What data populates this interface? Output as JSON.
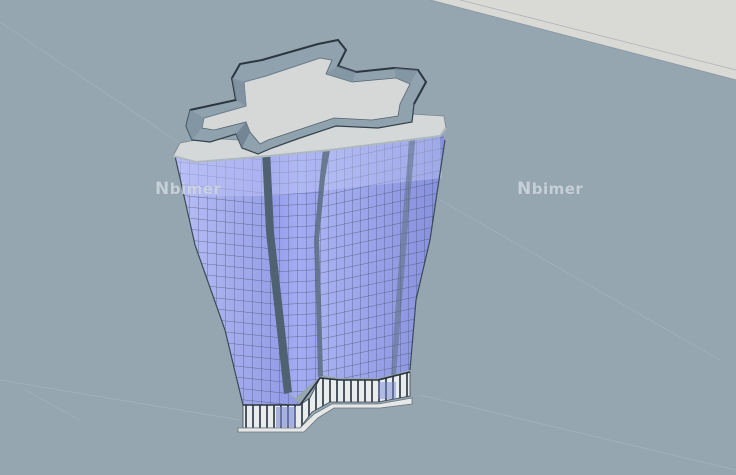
{
  "scene": {
    "ground_color": "#96a6b0",
    "sky_color": "#ffffff",
    "horizon_band_color": "#d8d8d6",
    "glass_front_color": "#9ea6ee",
    "glass_side_color": "#aab1f0",
    "glass_dark_color": "#7f8ad8",
    "mullion_color": "#2a3440",
    "frame_color": "#4f6272",
    "roof_color": "#d4d6d6",
    "parapet_glass_color": "#8fa3b0",
    "base_color": "#e8eaea"
  },
  "watermarks": [
    {
      "initial": "N",
      "text": "bimer"
    },
    {
      "initial": "N",
      "text": "bimer"
    }
  ]
}
